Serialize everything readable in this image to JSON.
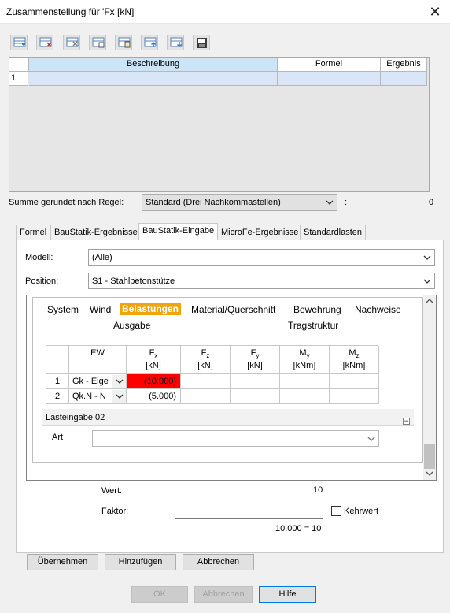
{
  "window": {
    "title": "Zusammenstellung für 'Fx [kN]'"
  },
  "grid": {
    "columns": [
      "Beschreibung",
      "Formel",
      "Ergebnis"
    ],
    "rows": [
      {
        "num": "1",
        "beschreibung": "",
        "formel": "",
        "ergebnis": ""
      }
    ]
  },
  "rounding": {
    "label": "Summe gerundet nach Regel:",
    "value": "Standard (Drei Nachkommastellen)",
    "colon": ":",
    "sum": "0"
  },
  "tabs": [
    "Formel",
    "BauStatik-Ergebnisse",
    "BauStatik-Eingabe",
    "MicroFe-Ergebnisse",
    "Standardlasten"
  ],
  "active_tab": "BauStatik-Eingabe",
  "modell": {
    "label": "Modell:",
    "value": "(Alle)"
  },
  "position": {
    "label": "Position:",
    "value": "S1 - Stahlbetonstütze"
  },
  "nav": {
    "row1": [
      "System",
      "Wind",
      "Belastungen",
      "Material/Querschnitt",
      "Bewehrung",
      "Nachweise"
    ],
    "row2": [
      "Ausgabe",
      "Tragstruktur"
    ],
    "active": "Belastungen"
  },
  "load_table": {
    "headers": [
      {
        "main": "EW",
        "sub": "",
        "unit": ""
      },
      {
        "main": "F",
        "sub": "x",
        "unit": "[kN]"
      },
      {
        "main": "F",
        "sub": "z",
        "unit": "[kN]"
      },
      {
        "main": "F",
        "sub": "y",
        "unit": "[kN]"
      },
      {
        "main": "M",
        "sub": "y",
        "unit": "[kNm]"
      },
      {
        "main": "M",
        "sub": "z",
        "unit": "[kNm]"
      }
    ],
    "rows": [
      {
        "num": "1",
        "ew": "Gk - Eige",
        "fx": "(10.000)"
      },
      {
        "num": "2",
        "ew": "Qk.N - N",
        "fx": "(5.000)"
      }
    ],
    "highlight_color": "#ff0000"
  },
  "lasteingabe": {
    "title": "Lasteingabe 02",
    "collapse": "−",
    "art_label": "Art",
    "art_value": ""
  },
  "wert": {
    "label": "Wert:",
    "value": "10"
  },
  "faktor": {
    "label": "Faktor:",
    "value": "",
    "kehrwert": "Kehrwert",
    "result": "10.000 = 10"
  },
  "action_buttons": [
    "Übernehmen",
    "Hinzufügen",
    "Abbrechen"
  ],
  "footer_buttons": {
    "ok": "OK",
    "abbrechen": "Abbrechen",
    "hilfe": "Hilfe"
  },
  "icons": [
    "add-row-icon",
    "delete-row-icon",
    "delete-all-icon",
    "copy-icon",
    "paste-icon",
    "move-up-icon",
    "move-down-icon",
    "save-icon"
  ]
}
